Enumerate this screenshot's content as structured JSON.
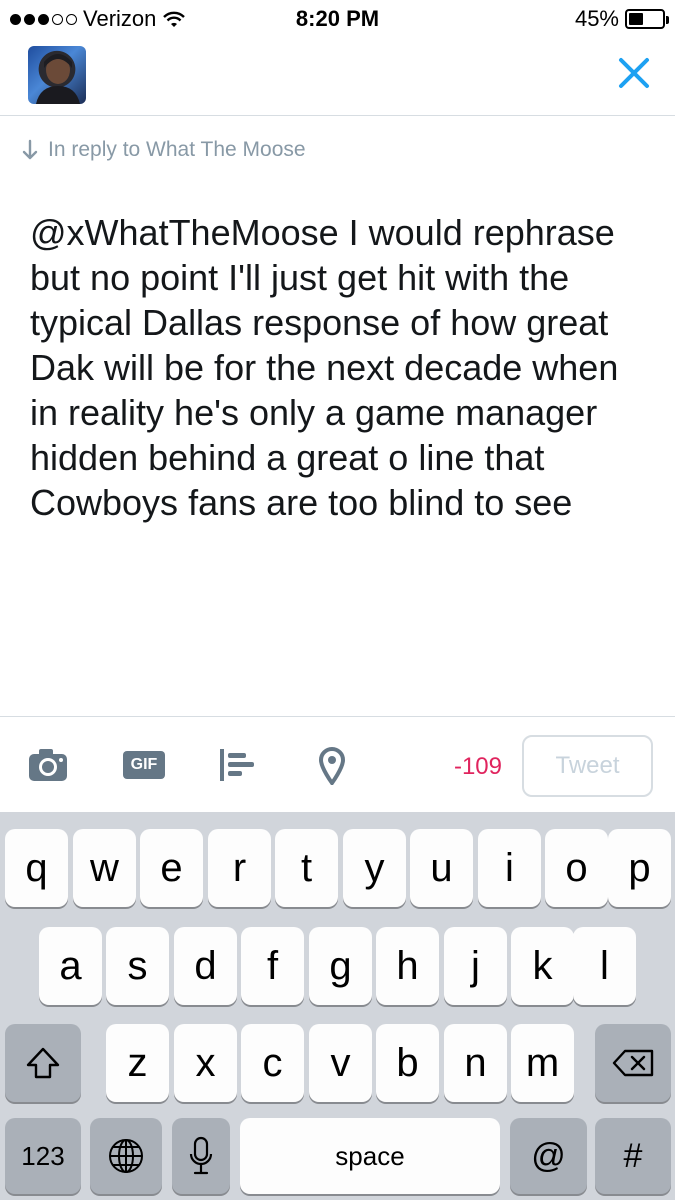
{
  "status_bar": {
    "carrier": "Verizon",
    "time": "8:20 PM",
    "battery": "45%",
    "battery_level": 0.45,
    "signal_bars": 3,
    "signal_max": 5
  },
  "header": {
    "avatar_icon": "avatar",
    "close_icon": "close-icon",
    "accent_color": "#1da1f2"
  },
  "reply": {
    "text": "In reply to What The Moose",
    "icon": "arrow-down-icon"
  },
  "compose": {
    "text": "@xWhatTheMoose I would rephrase but no point I'll just get hit with the typical Dallas response of how great Dak will be for the next decade when in reality he's only a game manager hidden behind a great o line that Cowboys fans are too blind to see"
  },
  "toolbar": {
    "icons": [
      "camera-icon",
      "gif-icon",
      "poll-icon",
      "location-pin-icon"
    ],
    "gif_label": "GIF",
    "char_count": "-109",
    "tweet_label": "Tweet",
    "counter_color": "#e0245e"
  },
  "keyboard": {
    "row1": [
      "q",
      "w",
      "e",
      "r",
      "t",
      "y",
      "u",
      "i",
      "o",
      "p"
    ],
    "row2": [
      "a",
      "s",
      "d",
      "f",
      "g",
      "h",
      "j",
      "k",
      "l"
    ],
    "row3": [
      "z",
      "x",
      "c",
      "v",
      "b",
      "n",
      "m"
    ],
    "numbers_label": "123",
    "space_label": "space",
    "at_label": "@",
    "hash_label": "#"
  }
}
